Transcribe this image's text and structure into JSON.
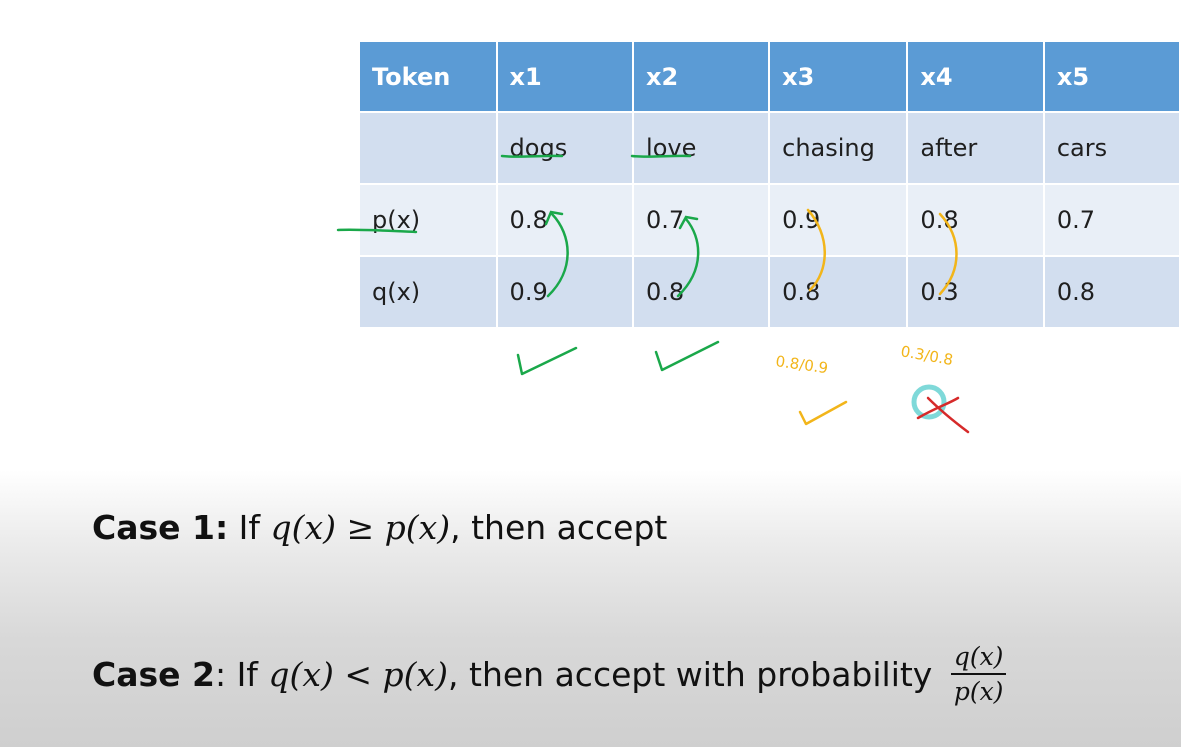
{
  "table": {
    "header": [
      "Token",
      "x1",
      "x2",
      "x3",
      "x4",
      "x5"
    ],
    "rows": [
      [
        "",
        "dogs",
        "love",
        "chasing",
        "after",
        "cars"
      ],
      [
        "p(x)",
        "0.8",
        "0.7",
        "0.9",
        "0.8",
        "0.7"
      ],
      [
        "q(x)",
        "0.9",
        "0.8",
        "0.8",
        "0.3",
        "0.8"
      ]
    ]
  },
  "annotations": {
    "ratio_x3": "0.8/0.9",
    "ratio_x4": "0.3/0.8",
    "colors": {
      "green": "#1aa84a",
      "yellow": "#f2b51a",
      "red": "#d62a2a",
      "cyan": "#5fcfcf"
    }
  },
  "case1": {
    "label": "Case 1:",
    "text_if": " If ",
    "math": "q(x) ≥ p(x)",
    "text_then": ", then accept"
  },
  "case2": {
    "label": "Case 2",
    "text_if": ": If ",
    "math": "q(x) < p(x)",
    "text_then": ", then accept with probability ",
    "frac_num": "q(x)",
    "frac_den": "p(x)"
  }
}
